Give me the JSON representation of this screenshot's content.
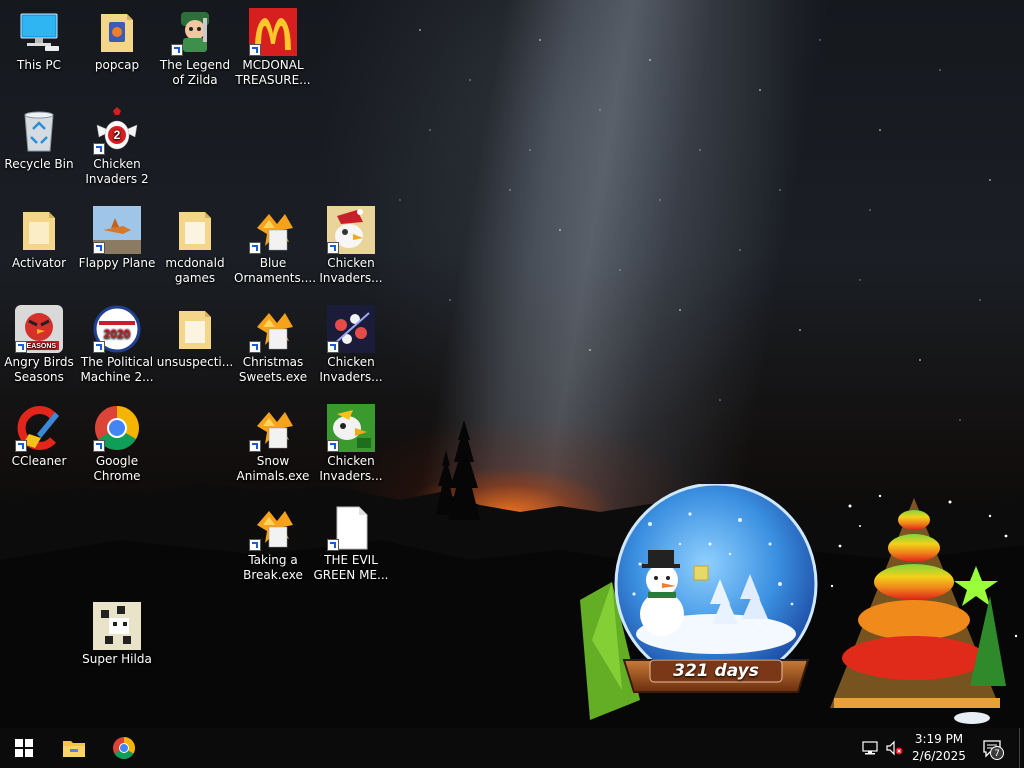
{
  "desktop": {
    "icons": [
      {
        "id": "this-pc",
        "label": "This PC"
      },
      {
        "id": "popcap",
        "label": "popcap"
      },
      {
        "id": "legend-zilda",
        "label": "The Legend of Zilda"
      },
      {
        "id": "mcdonal",
        "label": "MCDONAL TREASURE..."
      },
      {
        "id": "recycle-bin",
        "label": "Recycle Bin"
      },
      {
        "id": "chicken-invaders-2",
        "label": "Chicken Invaders 2"
      },
      {
        "id": "activator",
        "label": "Activator"
      },
      {
        "id": "flappy-plane",
        "label": "Flappy Plane"
      },
      {
        "id": "mcdonald-games",
        "label": "mcdonald games"
      },
      {
        "id": "blue-ornaments",
        "label": "Blue Ornaments...."
      },
      {
        "id": "chicken-invaders-a",
        "label": "Chicken Invaders..."
      },
      {
        "id": "angry-birds",
        "label": "Angry Birds Seasons"
      },
      {
        "id": "political-machine",
        "label": "The Political Machine 2..."
      },
      {
        "id": "unsuspecti",
        "label": "unsuspecti..."
      },
      {
        "id": "christmas-sweets",
        "label": "Christmas Sweets.exe"
      },
      {
        "id": "chicken-invaders-b",
        "label": "Chicken Invaders..."
      },
      {
        "id": "ccleaner",
        "label": "CCleaner"
      },
      {
        "id": "google-chrome",
        "label": "Google Chrome"
      },
      {
        "id": "snow-animals",
        "label": "Snow Animals.exe"
      },
      {
        "id": "chicken-invaders-c",
        "label": "Chicken Invaders..."
      },
      {
        "id": "taking-a-break",
        "label": "Taking a Break.exe"
      },
      {
        "id": "evil-green",
        "label": "THE EVIL GREEN ME..."
      },
      {
        "id": "super-hilda",
        "label": "Super Hilda"
      }
    ],
    "widgets": {
      "countdown_text": "321 days"
    }
  },
  "logos": {
    "political_badge": "2020",
    "angry_badge": "SEASONS",
    "chicken_badge": "2"
  },
  "taskbar": {
    "time": "3:19 PM",
    "date": "2/6/2025",
    "notification_count": "7",
    "colors": {
      "bg": "#0b0b0c",
      "accent": "#0078d7"
    }
  }
}
